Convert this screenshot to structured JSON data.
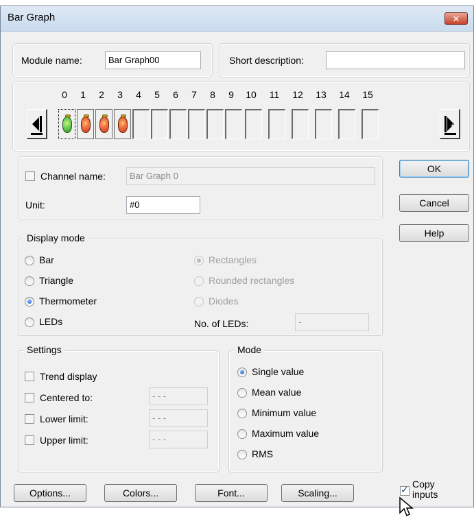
{
  "window": {
    "title": "Bar Graph",
    "close_icon": "close-icon"
  },
  "module": {
    "name_label": "Module name:",
    "name_value": "Bar Graph00",
    "desc_label": "Short description:",
    "desc_value": ""
  },
  "channels": {
    "numbers": [
      "0",
      "1",
      "2",
      "3",
      "4",
      "5",
      "6",
      "7",
      "8",
      "9",
      "10",
      "11",
      "12",
      "13",
      "14",
      "15"
    ],
    "active_count": 4,
    "selected_index": 0,
    "led_icons": [
      "led-green-icon",
      "led-red-icon",
      "led-red-icon",
      "led-red-icon"
    ],
    "prev_icon": "arrow-left-icon",
    "next_icon": "arrow-right-icon"
  },
  "channel": {
    "name_label": "Channel name:",
    "name_value": "Bar Graph 0",
    "name_checked": false,
    "unit_label": "Unit:",
    "unit_value": "#0"
  },
  "buttons": {
    "ok": "OK",
    "cancel": "Cancel",
    "help": "Help"
  },
  "display_mode": {
    "title": "Display mode",
    "left_options": [
      "Bar",
      "Triangle",
      "Thermometer",
      "LEDs"
    ],
    "left_selected": "Thermometer",
    "right_options": [
      "Rectangles",
      "Rounded rectangles",
      "Diodes"
    ],
    "right_selected": "Rectangles",
    "leds_label": "No. of LEDs:",
    "leds_value": "-"
  },
  "settings": {
    "title": "Settings",
    "trend_label": "Trend display",
    "items": [
      {
        "label": "Centered to:",
        "value": "- - -"
      },
      {
        "label": "Lower limit:",
        "value": "- - -"
      },
      {
        "label": "Upper limit:",
        "value": "- - -"
      }
    ]
  },
  "mode": {
    "title": "Mode",
    "options": [
      "Single value",
      "Mean value",
      "Minimum value",
      "Maximum value",
      "RMS"
    ],
    "selected": "Single value"
  },
  "bottom": {
    "options": "Options...",
    "colors": "Colors...",
    "font": "Font...",
    "scaling": "Scaling...",
    "copy_inputs": "Copy inputs",
    "copy_checked": true
  },
  "theme": {
    "accent": "#1e56b8",
    "close": "#c7442c",
    "led_green": "#2c9a1c",
    "led_red": "#d7351b"
  }
}
